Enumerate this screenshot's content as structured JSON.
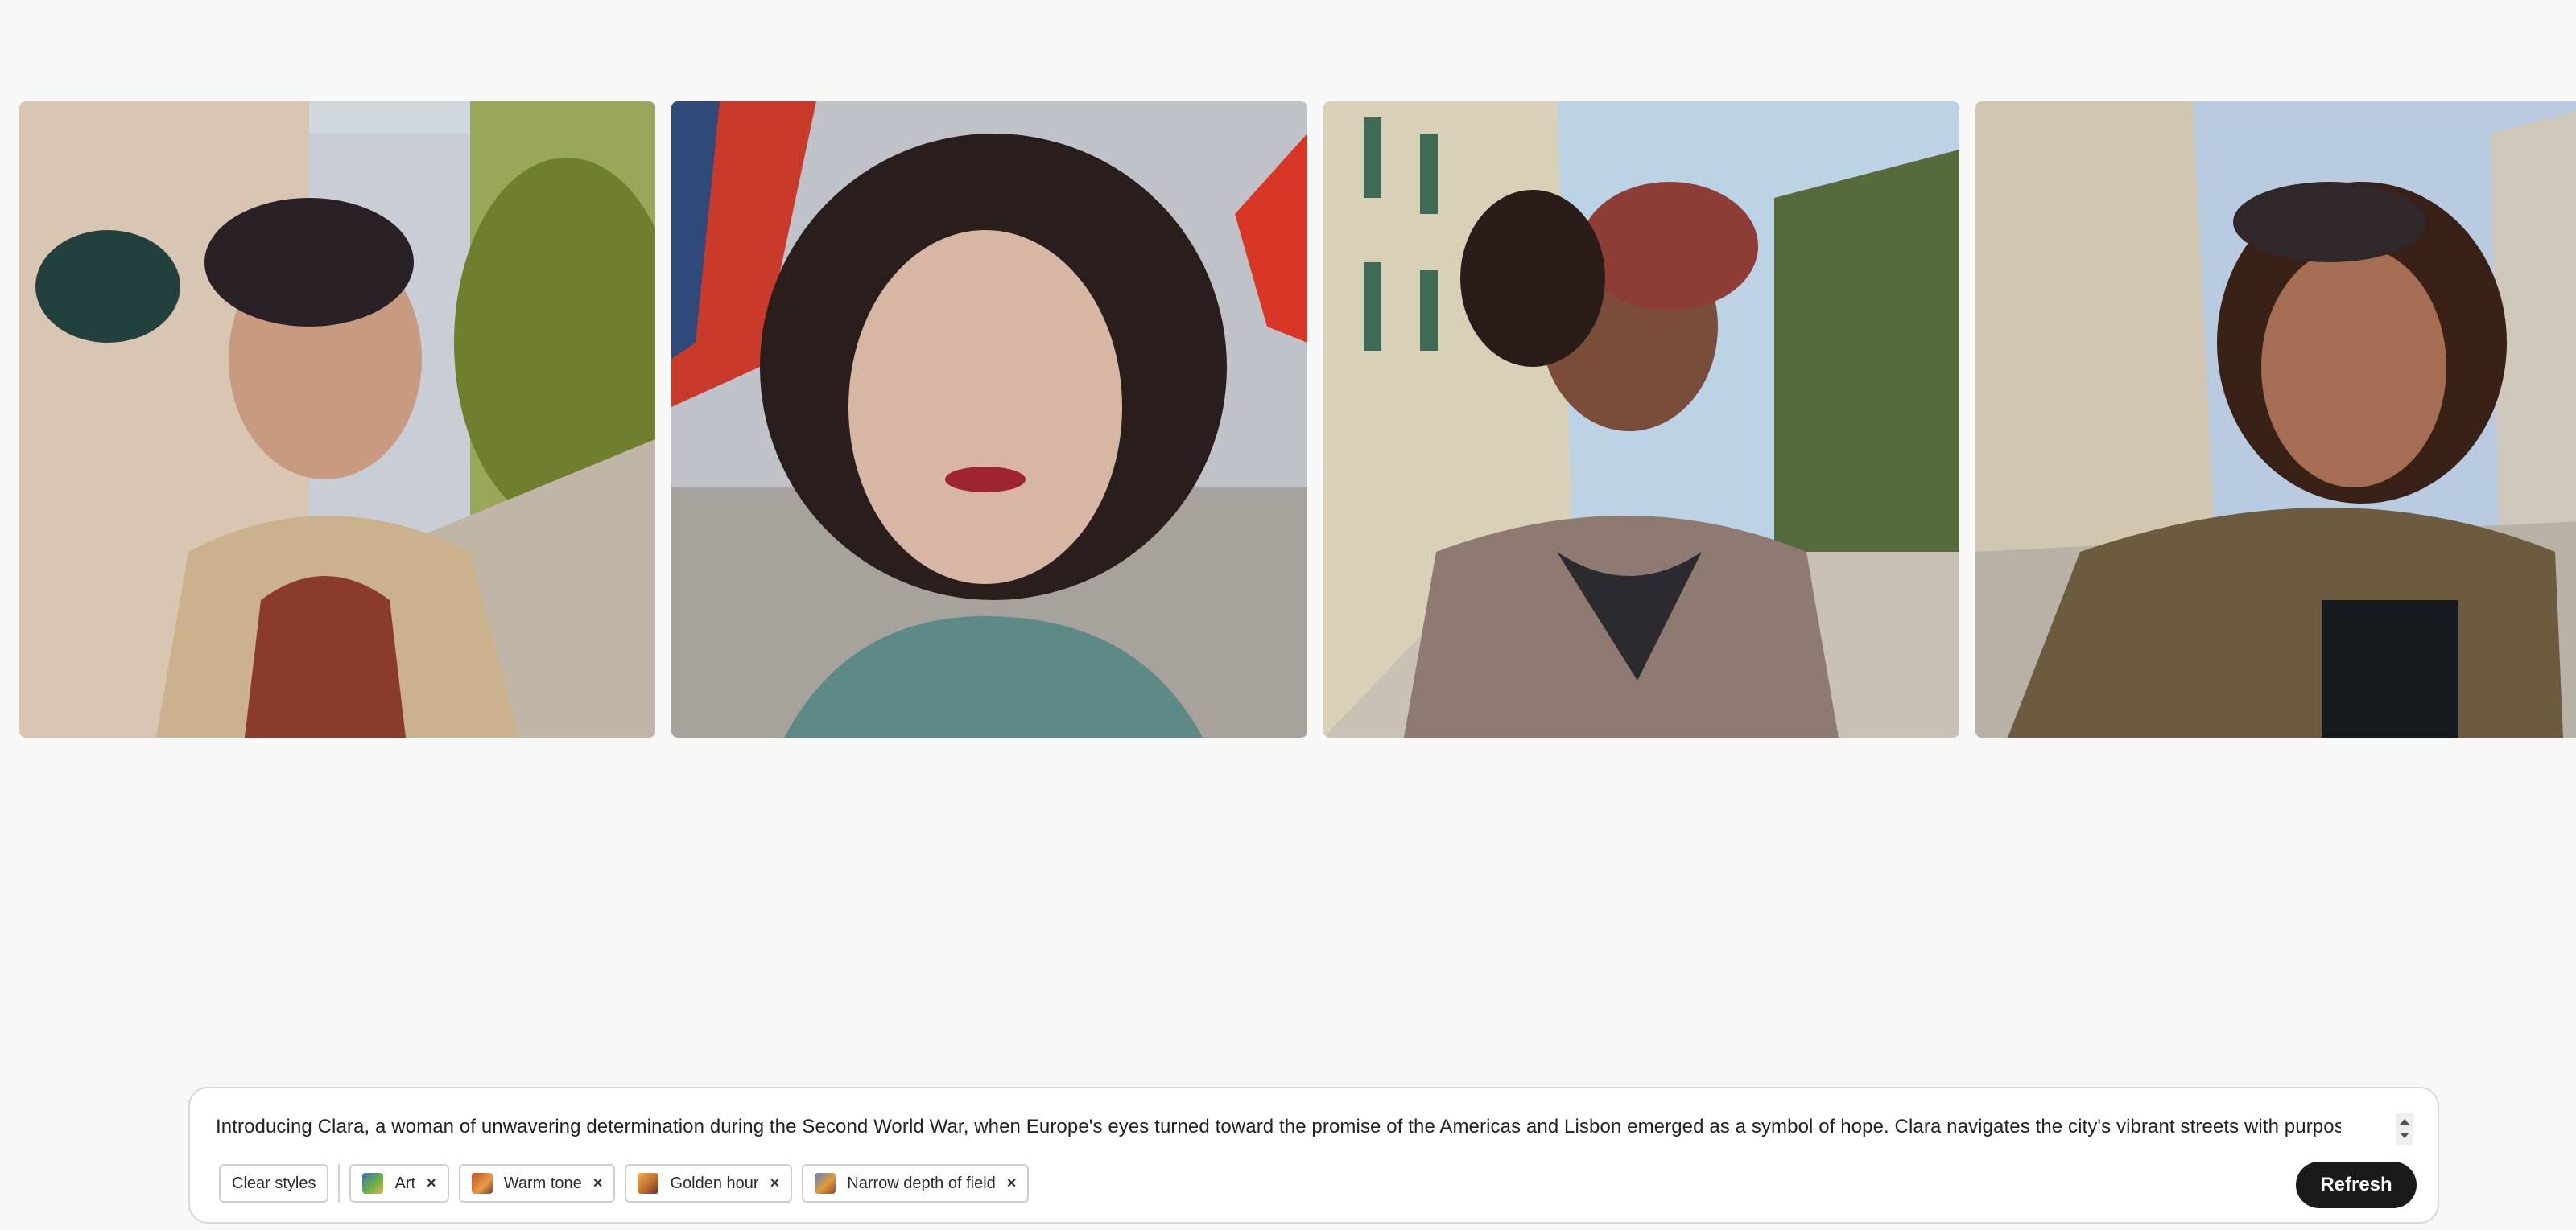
{
  "gallery": {
    "images": [
      {
        "label": "generated-portrait-1"
      },
      {
        "label": "generated-portrait-2"
      },
      {
        "label": "generated-portrait-3"
      },
      {
        "label": "generated-portrait-4"
      }
    ]
  },
  "prompt": {
    "text": "Introducing Clara, a woman of unwavering determination during the Second World War, when Europe's eyes turned toward the promise of the Americas and Lisbon emerged as a symbol of hope. Clara navigates the city's vibrant streets with purpose,"
  },
  "styles": {
    "clear_label": "Clear styles",
    "chips": [
      {
        "label": "Art",
        "icon": "art-style-thumbnail"
      },
      {
        "label": "Warm tone",
        "icon": "warm-tone-thumbnail"
      },
      {
        "label": "Golden hour",
        "icon": "golden-hour-thumbnail"
      },
      {
        "label": "Narrow depth of field",
        "icon": "depth-of-field-thumbnail"
      }
    ],
    "remove_glyph": "×"
  },
  "actions": {
    "refresh_label": "Refresh"
  },
  "colors": {
    "background": "#f8f8f8",
    "refresh_button": "#1a1a1a"
  }
}
